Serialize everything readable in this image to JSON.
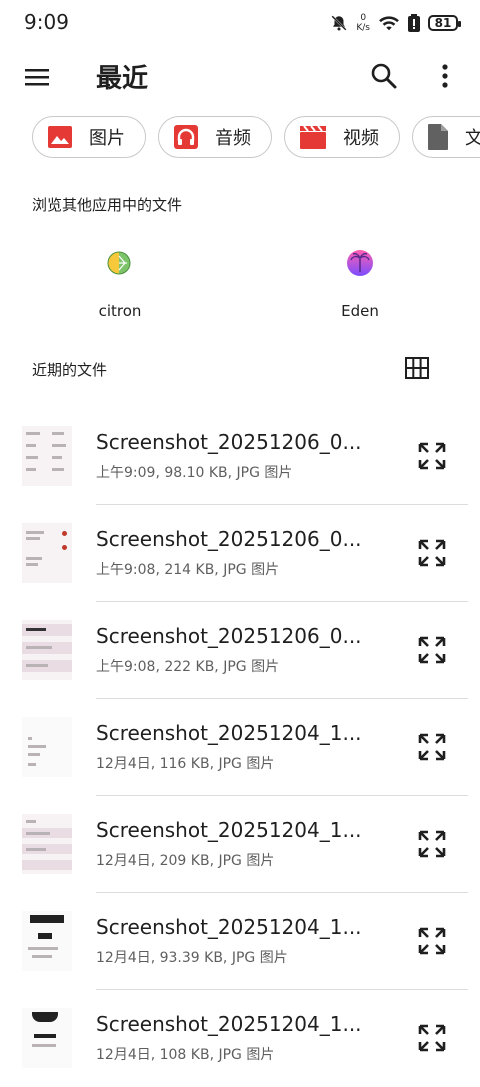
{
  "status_bar": {
    "time": "9:09",
    "net_speed_value": "0",
    "net_speed_unit": "K/s",
    "battery": "81"
  },
  "app_bar": {
    "title": "最近"
  },
  "chips": [
    {
      "label": "图片",
      "icon": "image-icon",
      "color": "#e53935"
    },
    {
      "label": "音频",
      "icon": "headphones-icon",
      "color": "#e53935"
    },
    {
      "label": "视频",
      "icon": "clapperboard-icon",
      "color": "#e53935"
    },
    {
      "label": "文档",
      "icon": "document-icon",
      "color": "#616161"
    }
  ],
  "other_apps": {
    "title": "浏览其他应用中的文件",
    "apps": [
      {
        "label": "citron",
        "icon": "citron-app-icon"
      },
      {
        "label": "Eden",
        "icon": "eden-app-icon"
      }
    ]
  },
  "recent": {
    "title": "近期的文件",
    "files": [
      {
        "name": "Screenshot_20251206_0...",
        "meta": "上午9:09, 98.10 KB, JPG 图片"
      },
      {
        "name": "Screenshot_20251206_0...",
        "meta": "上午9:08, 214 KB, JPG 图片"
      },
      {
        "name": "Screenshot_20251206_0...",
        "meta": "上午9:08, 222 KB, JPG 图片"
      },
      {
        "name": "Screenshot_20251204_1...",
        "meta": "12月4日, 116 KB, JPG 图片"
      },
      {
        "name": "Screenshot_20251204_1...",
        "meta": "12月4日, 209 KB, JPG 图片"
      },
      {
        "name": "Screenshot_20251204_1...",
        "meta": "12月4日, 93.39 KB, JPG 图片"
      },
      {
        "name": "Screenshot_20251204_1...",
        "meta": "12月4日, 108 KB, JPG 图片"
      }
    ]
  }
}
